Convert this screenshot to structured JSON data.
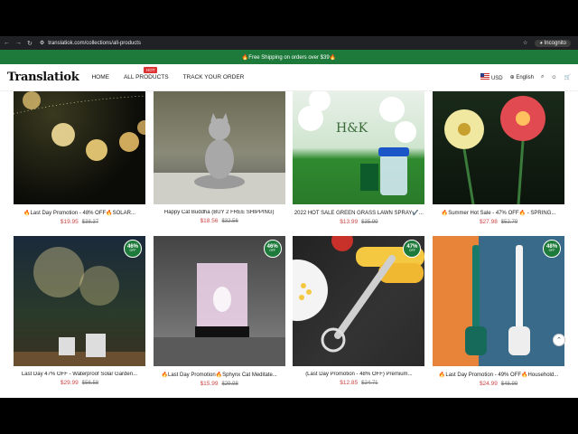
{
  "browser": {
    "url": "translatiok.com/collections/all-products",
    "incognito_label": "Incognito"
  },
  "banner": {
    "text": "🔥Free Shipping on orders over $39🔥"
  },
  "header": {
    "logo": "Translatiok",
    "menu": {
      "home": "HOME",
      "all_products": "ALL PRODUCTS",
      "hot_badge": "HOT",
      "track": "TRACK YOUR ORDER"
    },
    "currency": "USD",
    "language": "English"
  },
  "products": [
    {
      "title": "🔥Last Day Promotion - 48% OFF🔥SOLAR...",
      "price": "$19.95",
      "old_price": "$38.37",
      "badge": ""
    },
    {
      "title": "Happy Cat Buddha (BUY 2 FREE SHIPPING)",
      "price": "$18.56",
      "old_price": "$32.56",
      "badge": ""
    },
    {
      "title": "2022 HOT SALE GREEN GRASS LAWN SPRAY✔️...",
      "price": "$13.99",
      "old_price": "$35.99",
      "badge": ""
    },
    {
      "title": "🔥Summer Hot Sale - 47% OFF🔥 - SPRING...",
      "price": "$27.98",
      "old_price": "$52.79",
      "badge": ""
    },
    {
      "title": "Last Day 47% OFF - Waterproof Solar Garden...",
      "price": "$29.99",
      "old_price": "$56.58",
      "badge": "46%"
    },
    {
      "title": "🔥Last Day Promotion🔥Sphynx Cat Meditate...",
      "price": "$15.99",
      "old_price": "$29.98",
      "badge": "46%"
    },
    {
      "title": "(Last Day Promotion - 48% OFF) Premium...",
      "price": "$12.85",
      "old_price": "$24.71",
      "badge": "47%"
    },
    {
      "title": "🔥Last Day Promotion - 49% OFF🔥Household...",
      "price": "$24.99",
      "old_price": "$48.99",
      "badge": "48%"
    }
  ],
  "badge_sub": "OFF",
  "colors": {
    "brand_green": "#1e7a3a",
    "sale_red": "#cc4444"
  }
}
